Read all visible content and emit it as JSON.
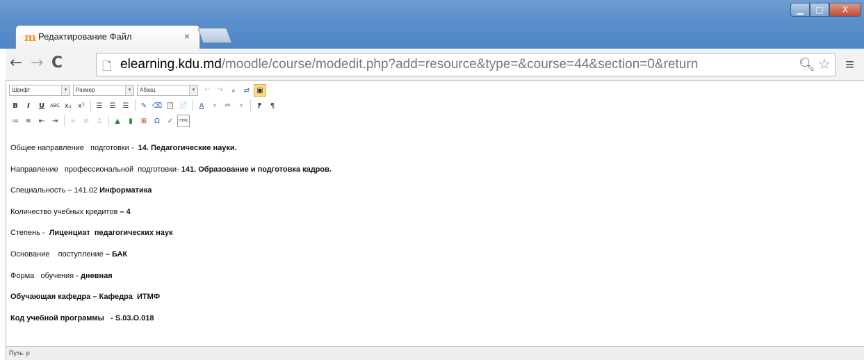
{
  "browser": {
    "tab_title": "Редактирование Файл",
    "tab_close": "×",
    "url_host": "elearning.kdu.md",
    "url_path": "/moodle/course/modedit.php?add=resource&type=&course=44&section=0&return"
  },
  "toolbar": {
    "font_select": "Шрифт",
    "size_select": "Размер",
    "paragraph_select": "Абзац",
    "html_button": "HTML"
  },
  "content": {
    "lines": [
      {
        "normal": "Общее направление   подготовки -  ",
        "bold": "14. Педагогические науки."
      },
      {
        "normal": "Направление   профессиональной  подготовки- ",
        "bold": "141. Образование и подготовка кадров."
      },
      {
        "normal": "Специальность – 141.02 ",
        "bold": "Информатика"
      },
      {
        "normal": "Количество учебных кредитов ",
        "bold": "– 4"
      },
      {
        "normal": "Степень -  ",
        "bold": "Лиценциат  педагогических наук"
      },
      {
        "normal": "Основание    поступление ",
        "bold": "– БАК"
      },
      {
        "normal": "Форма   обучения - ",
        "bold": "дневная"
      },
      {
        "normal": "",
        "bold": "Обучающая кафедра – Кафедра  ИТМФ"
      },
      {
        "normal": "",
        "bold": "Код учебной программы   - S.03.O.018"
      }
    ]
  },
  "status": {
    "path": "Путь: p"
  }
}
